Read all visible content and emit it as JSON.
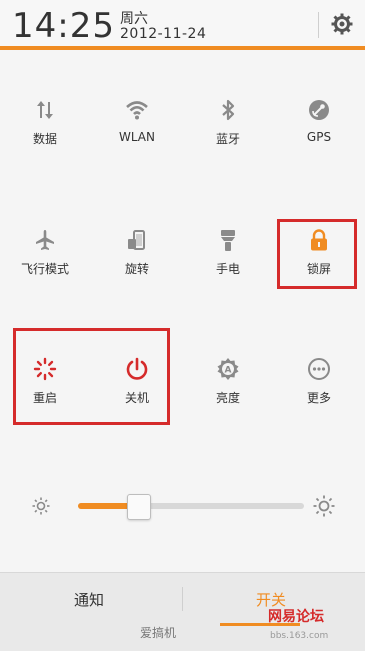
{
  "status": {
    "time": "14:25",
    "weekday": "周六",
    "date": "2012-11-24"
  },
  "tiles": [
    {
      "label": "数据"
    },
    {
      "label": "WLAN"
    },
    {
      "label": "蓝牙"
    },
    {
      "label": "GPS"
    },
    {
      "label": "飞行模式"
    },
    {
      "label": "旋转"
    },
    {
      "label": "手电"
    },
    {
      "label": "锁屏"
    },
    {
      "label": "重启"
    },
    {
      "label": "关机"
    },
    {
      "label": "亮度"
    },
    {
      "label": "更多"
    }
  ],
  "brightness": {
    "level": 0.27
  },
  "tabs": {
    "notify": "通知",
    "switches": "开关"
  },
  "watermark": {
    "left": "爱搞机",
    "right": "网易论坛",
    "url": "bbs.163.com"
  },
  "colors": {
    "accent": "#f08c22",
    "highlight": "#d52b2b"
  }
}
